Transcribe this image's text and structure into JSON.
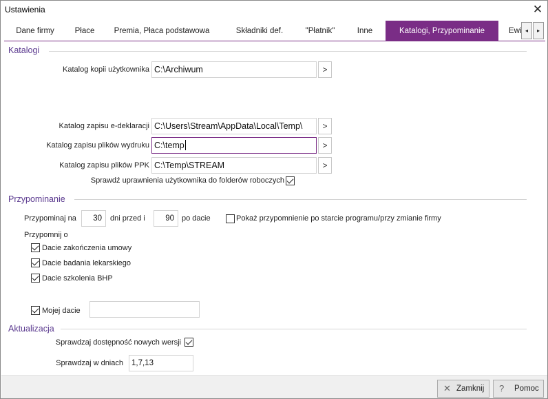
{
  "window": {
    "title": "Ustawienia"
  },
  "tabs": [
    {
      "label": "Dane firmy"
    },
    {
      "label": "Płace"
    },
    {
      "label": "Premia, Płaca podstawowa"
    },
    {
      "label": "Składniki def."
    },
    {
      "label": "\"Płatnik\""
    },
    {
      "label": "Inne"
    },
    {
      "label": "Katalogi, Przypominanie",
      "active": true
    },
    {
      "label": "Ewi"
    }
  ],
  "tab_scroll": {
    "left": "◂",
    "right": "▸"
  },
  "katalogi": {
    "title": "Katalogi",
    "kopii": {
      "label": "Katalog kopii użytkownika",
      "value": "C:\\Archiwum"
    },
    "edeklaracji": {
      "label": "Katalog zapisu e-deklaracji",
      "value": "C:\\Users\\Stream\\AppData\\Local\\Temp\\"
    },
    "wydruku": {
      "label": "Katalog zapisu plików wydruku",
      "value": "C:\\temp"
    },
    "ppk": {
      "label": "Katalog zapisu plików PPK",
      "value": "C:\\Temp\\STREAM"
    },
    "browse_label": ">",
    "sprawdz_uprawnienia": {
      "label": "Sprawdź uprawnienia użytkownika do folderów roboczych",
      "checked": true
    }
  },
  "przypominanie": {
    "title": "Przypominanie",
    "przypominaj_na": "Przypominaj na",
    "days_before": "30",
    "dni_przed_i": "dni przed i",
    "days_after": "90",
    "po_dacie": "po dacie",
    "pokaz": {
      "label": "Pokaż przypomnienie po starcie programu/przy zmianie firmy",
      "checked": false
    },
    "przypomnij_o": "Przypomnij o",
    "items": [
      {
        "label": "Dacie zakończenia umowy",
        "checked": true
      },
      {
        "label": "Dacie badania lekarskiego",
        "checked": true
      },
      {
        "label": "Dacie szkolenia BHP",
        "checked": true
      }
    ],
    "moja_data": {
      "label": "Mojej dacie",
      "checked": true,
      "value": ""
    }
  },
  "aktualizacja": {
    "title": "Aktualizacja",
    "sprawdzaj": {
      "label": "Sprawdzaj dostępność nowych wersji",
      "checked": true
    },
    "w_dniach": {
      "label": "Sprawdzaj w dniach",
      "value": "1,7,13"
    }
  },
  "footer": {
    "zamknij": {
      "label": "Zamknij",
      "icon": "close-icon"
    },
    "pomoc": {
      "label": "Pomoc",
      "icon": "help-icon"
    }
  }
}
